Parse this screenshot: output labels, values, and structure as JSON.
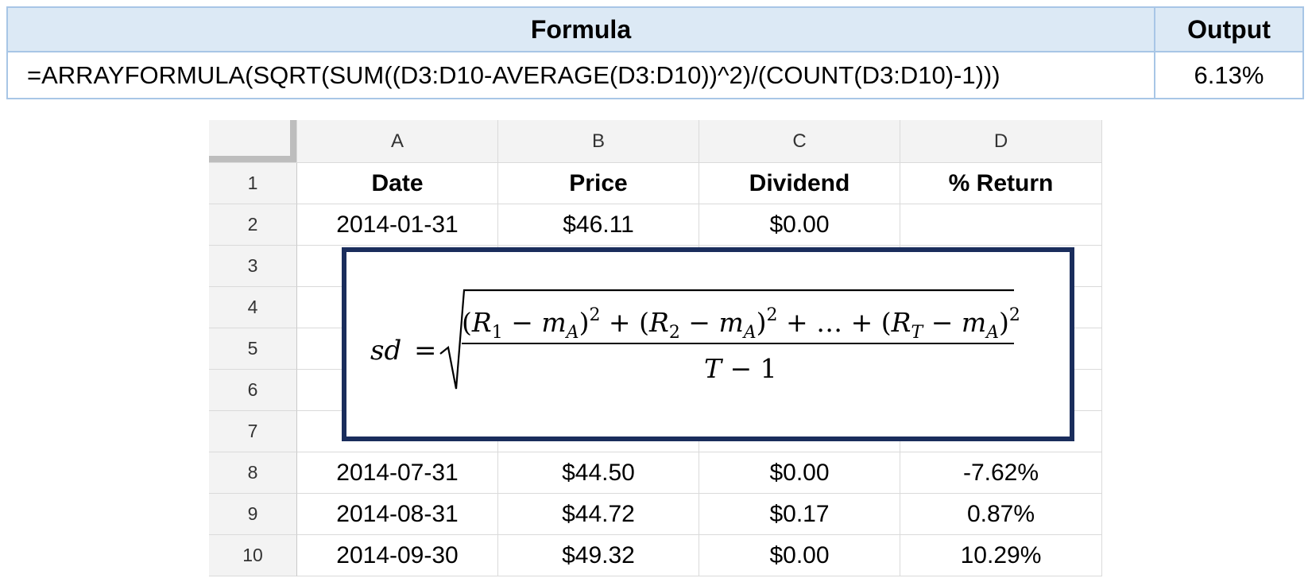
{
  "formula_table": {
    "formula_header": "Formula",
    "output_header": "Output",
    "formula_value": "=ARRAYFORMULA(SQRT(SUM((D3:D10-AVERAGE(D3:D10))^2)/(COUNT(D3:D10)-1)))",
    "output_value": "6.13%"
  },
  "sheet": {
    "columns": [
      "A",
      "B",
      "C",
      "D"
    ],
    "row_numbers": [
      "1",
      "2",
      "3",
      "4",
      "5",
      "6",
      "7",
      "8",
      "9",
      "10"
    ],
    "header_row": [
      "Date",
      "Price",
      "Dividend",
      "% Return"
    ],
    "rows": [
      [
        "2014-01-31",
        "$46.11",
        "$0.00",
        ""
      ],
      [
        "",
        "",
        "",
        ""
      ],
      [
        "",
        "",
        "",
        ""
      ],
      [
        "",
        "",
        "",
        ""
      ],
      [
        "",
        "",
        "",
        ""
      ],
      [
        "",
        "",
        "",
        ""
      ],
      [
        "2014-07-31",
        "$44.50",
        "$0.00",
        "-7.62%"
      ],
      [
        "2014-08-31",
        "$44.72",
        "$0.17",
        "0.87%"
      ],
      [
        "2014-09-30",
        "$49.32",
        "$0.00",
        "10.29%"
      ]
    ]
  },
  "math_box": {
    "lhs": "sd",
    "equals": "=",
    "numerator": "(R1 − mA)² + (R2 − mA)² + … + (RT − mA)²",
    "denominator": "T − 1",
    "border_color": "#1a2d5c"
  }
}
